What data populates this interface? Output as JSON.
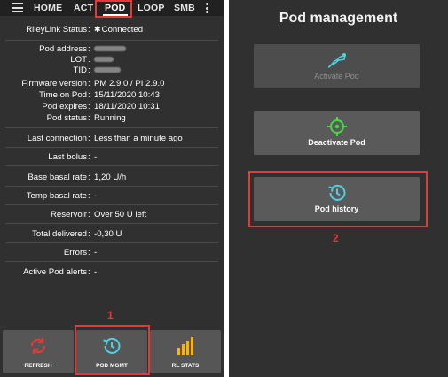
{
  "left": {
    "tabs": [
      "HOME",
      "ACT",
      "POD",
      "LOOP",
      "SMB"
    ],
    "active_tab": "POD",
    "rows": [
      {
        "label": "RileyLink Status",
        "value": "Connected",
        "bluetooth": true
      },
      {
        "label": "Pod address",
        "value": "",
        "blur": 36
      },
      {
        "label": "LOT",
        "value": "",
        "blur": 22
      },
      {
        "label": "TID",
        "value": "",
        "blur": 30
      },
      {
        "label": "Firmware version",
        "value": "PM 2.9.0 / PI 2.9.0"
      },
      {
        "label": "Time on Pod",
        "value": "15/11/2020 10:43"
      },
      {
        "label": "Pod expires",
        "value": "18/11/2020 10:31"
      },
      {
        "label": "Pod status",
        "value": "Running"
      },
      {
        "label": "Last connection",
        "value": "Less than a minute ago"
      },
      {
        "label": "Last bolus",
        "value": "-"
      },
      {
        "label": "Base basal rate",
        "value": "1,20 U/h"
      },
      {
        "label": "Temp basal rate",
        "value": "-"
      },
      {
        "label": "Reservoir",
        "value": "Over 50 U left"
      },
      {
        "label": "Total delivered",
        "value": "-0,30 U"
      },
      {
        "label": "Errors",
        "value": "-"
      },
      {
        "label": "Active Pod alerts",
        "value": "-"
      }
    ],
    "buttons": [
      {
        "label": "REFRESH",
        "icon": "refresh-icon",
        "color": "#e53935"
      },
      {
        "label": "POD MGMT",
        "icon": "history-icon",
        "color": "#4dd0e1"
      },
      {
        "label": "RL STATS",
        "icon": "bar-chart-icon",
        "color": "#ffb300"
      }
    ],
    "marker": "1"
  },
  "right": {
    "title": "Pod management",
    "buttons": [
      {
        "label": "Activate Pod",
        "icon": "pod-icon",
        "enabled": false
      },
      {
        "label": "Deactivate Pod",
        "icon": "crosshair-icon",
        "enabled": true
      },
      {
        "label": "Pod history",
        "icon": "history-icon",
        "enabled": true
      }
    ],
    "marker": "2"
  },
  "colors": {
    "background": "#303030",
    "topbar": "#212121",
    "button": "#565656",
    "highlight": "#e53935",
    "accent_cyan": "#4dd0e1",
    "accent_green": "#43d943",
    "accent_orange": "#ffb300"
  }
}
